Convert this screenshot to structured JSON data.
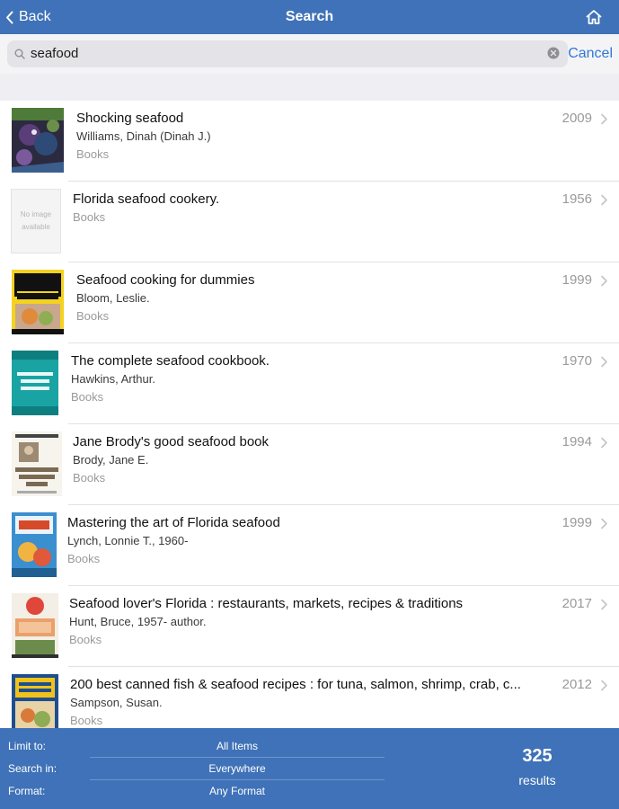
{
  "nav": {
    "back_label": "Back",
    "title": "Search",
    "home_icon": "home-icon"
  },
  "search": {
    "value": "seafood",
    "cancel_label": "Cancel"
  },
  "results": [
    {
      "title": "Shocking seafood",
      "author": "Williams, Dinah (Dinah J.)",
      "format": "Books",
      "year": "2009",
      "cover": "dark"
    },
    {
      "title": "Florida seafood cookery.",
      "author": "",
      "format": "Books",
      "year": "1956",
      "cover": "none",
      "noimage_line1": "No image",
      "noimage_line2": "available"
    },
    {
      "title": "Seafood cooking for dummies",
      "author": "Bloom, Leslie.",
      "format": "Books",
      "year": "1999",
      "cover": "dummies"
    },
    {
      "title": "The complete seafood cookbook.",
      "author": "Hawkins, Arthur.",
      "format": "Books",
      "year": "1970",
      "cover": "teal"
    },
    {
      "title": "Jane Brody's good seafood book",
      "author": "Brody, Jane E.",
      "format": "Books",
      "year": "1994",
      "cover": "brody"
    },
    {
      "title": "Mastering the art of Florida seafood",
      "author": "Lynch, Lonnie T., 1960-",
      "format": "Books",
      "year": "1999",
      "cover": "florida"
    },
    {
      "title": "Seafood lover's Florida : restaurants, markets, recipes & traditions",
      "author": "Hunt, Bruce, 1957- author.",
      "format": "Books",
      "year": "2017",
      "cover": "lover"
    },
    {
      "title": "200 best canned fish & seafood recipes : for tuna, salmon, shrimp, crab, c...",
      "author": "Sampson, Susan.",
      "format": "Books",
      "year": "2012",
      "cover": "canned"
    }
  ],
  "footer": {
    "limit_label": "Limit to:",
    "limit_value": "All Items",
    "searchin_label": "Search in:",
    "searchin_value": "Everywhere",
    "format_label": "Format:",
    "format_value": "Any Format",
    "count": "325",
    "count_label": "results"
  },
  "colors": {
    "nav_bg": "#3f72b8",
    "accent": "#2f77d6"
  }
}
